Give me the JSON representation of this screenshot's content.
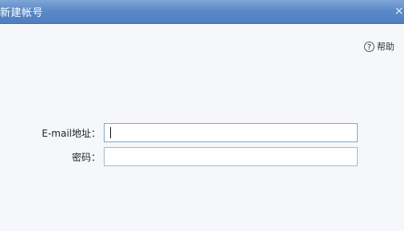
{
  "window": {
    "title": "新建帐号",
    "close_glyph": "×"
  },
  "help": {
    "icon_glyph": "?",
    "label": "帮助"
  },
  "form": {
    "email": {
      "label": "E-mail地址：",
      "value": ""
    },
    "password": {
      "label": "密码：",
      "value": ""
    }
  }
}
